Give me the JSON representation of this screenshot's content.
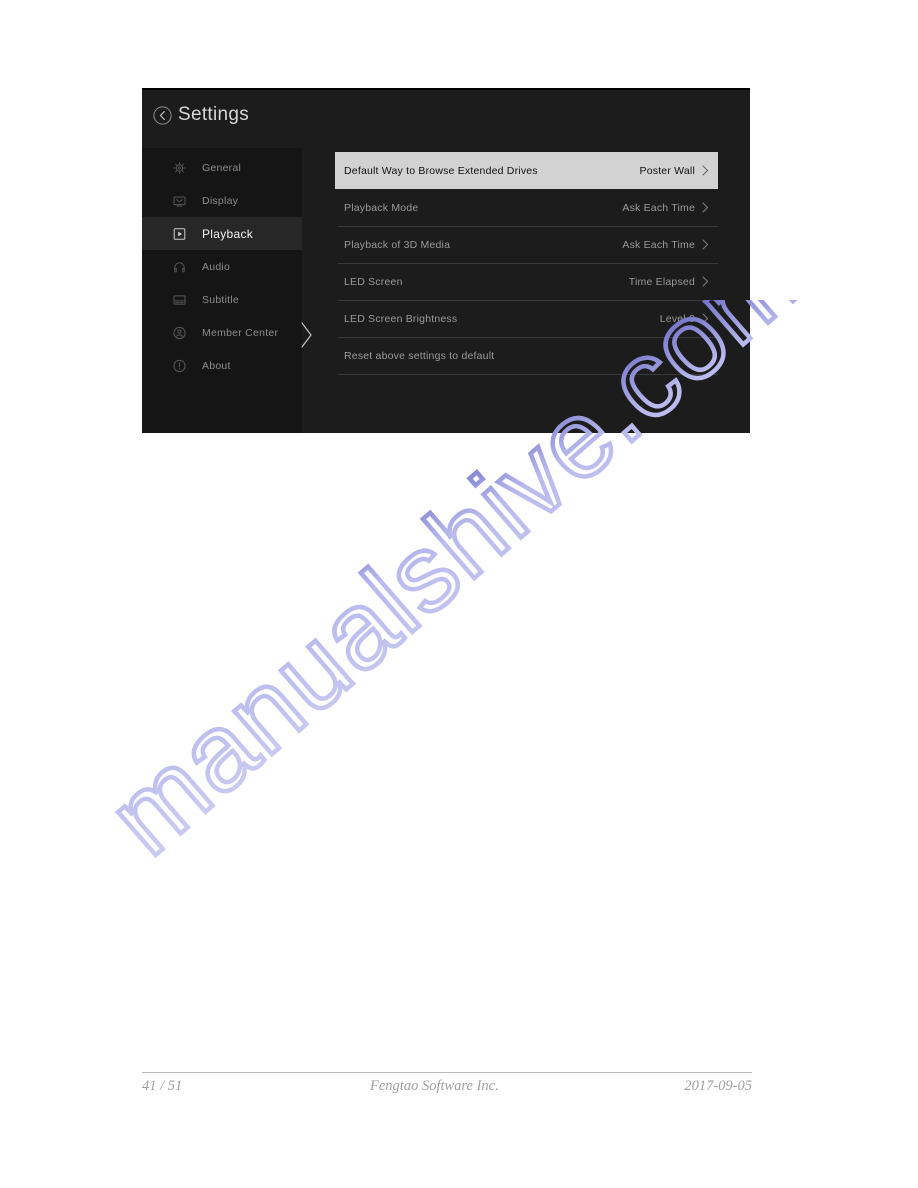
{
  "document": {
    "footer": {
      "page_number": "41 / 51",
      "company": "Fengtao Software Inc.",
      "date": "2017-09-05"
    },
    "watermark": "manualshive.com"
  },
  "screenshot": {
    "header": {
      "title": "Settings",
      "back_icon": "circle-chevron-left-icon"
    },
    "sidebar": {
      "items": [
        {
          "label": "General",
          "icon": "gear-icon",
          "active": false
        },
        {
          "label": "Display",
          "icon": "monitor-icon",
          "active": false
        },
        {
          "label": "Playback",
          "icon": "play-box-icon",
          "active": true
        },
        {
          "label": "Audio",
          "icon": "headphones-icon",
          "active": false
        },
        {
          "label": "Subtitle",
          "icon": "subtitle-box-icon",
          "active": false
        },
        {
          "label": "Member Center",
          "icon": "person-circle-icon",
          "active": false
        },
        {
          "label": "About",
          "icon": "info-circle-icon",
          "active": false
        }
      ]
    },
    "settings": {
      "rows": [
        {
          "label": "Default Way to Browse Extended Drives",
          "value": "Poster Wall",
          "chevron": true,
          "selected": true
        },
        {
          "label": "Playback Mode",
          "value": "Ask Each Time",
          "chevron": true,
          "selected": false
        },
        {
          "label": "Playback of 3D Media",
          "value": "Ask Each Time",
          "chevron": true,
          "selected": false
        },
        {
          "label": "LED Screen",
          "value": "Time Elapsed",
          "chevron": true,
          "selected": false
        },
        {
          "label": "LED Screen Brightness",
          "value": "Level 8",
          "chevron": true,
          "selected": false
        },
        {
          "label": "Reset above settings to default",
          "value": "",
          "chevron": false,
          "selected": false
        }
      ]
    },
    "colors": {
      "panel_bg": "#1c1c1c",
      "sidebar_bg": "#151515",
      "active_item_bg": "#272727",
      "selected_row_bg": "#d2d2d2",
      "muted_text": "#9a9a9a",
      "title_text": "#d6d6d6"
    }
  }
}
